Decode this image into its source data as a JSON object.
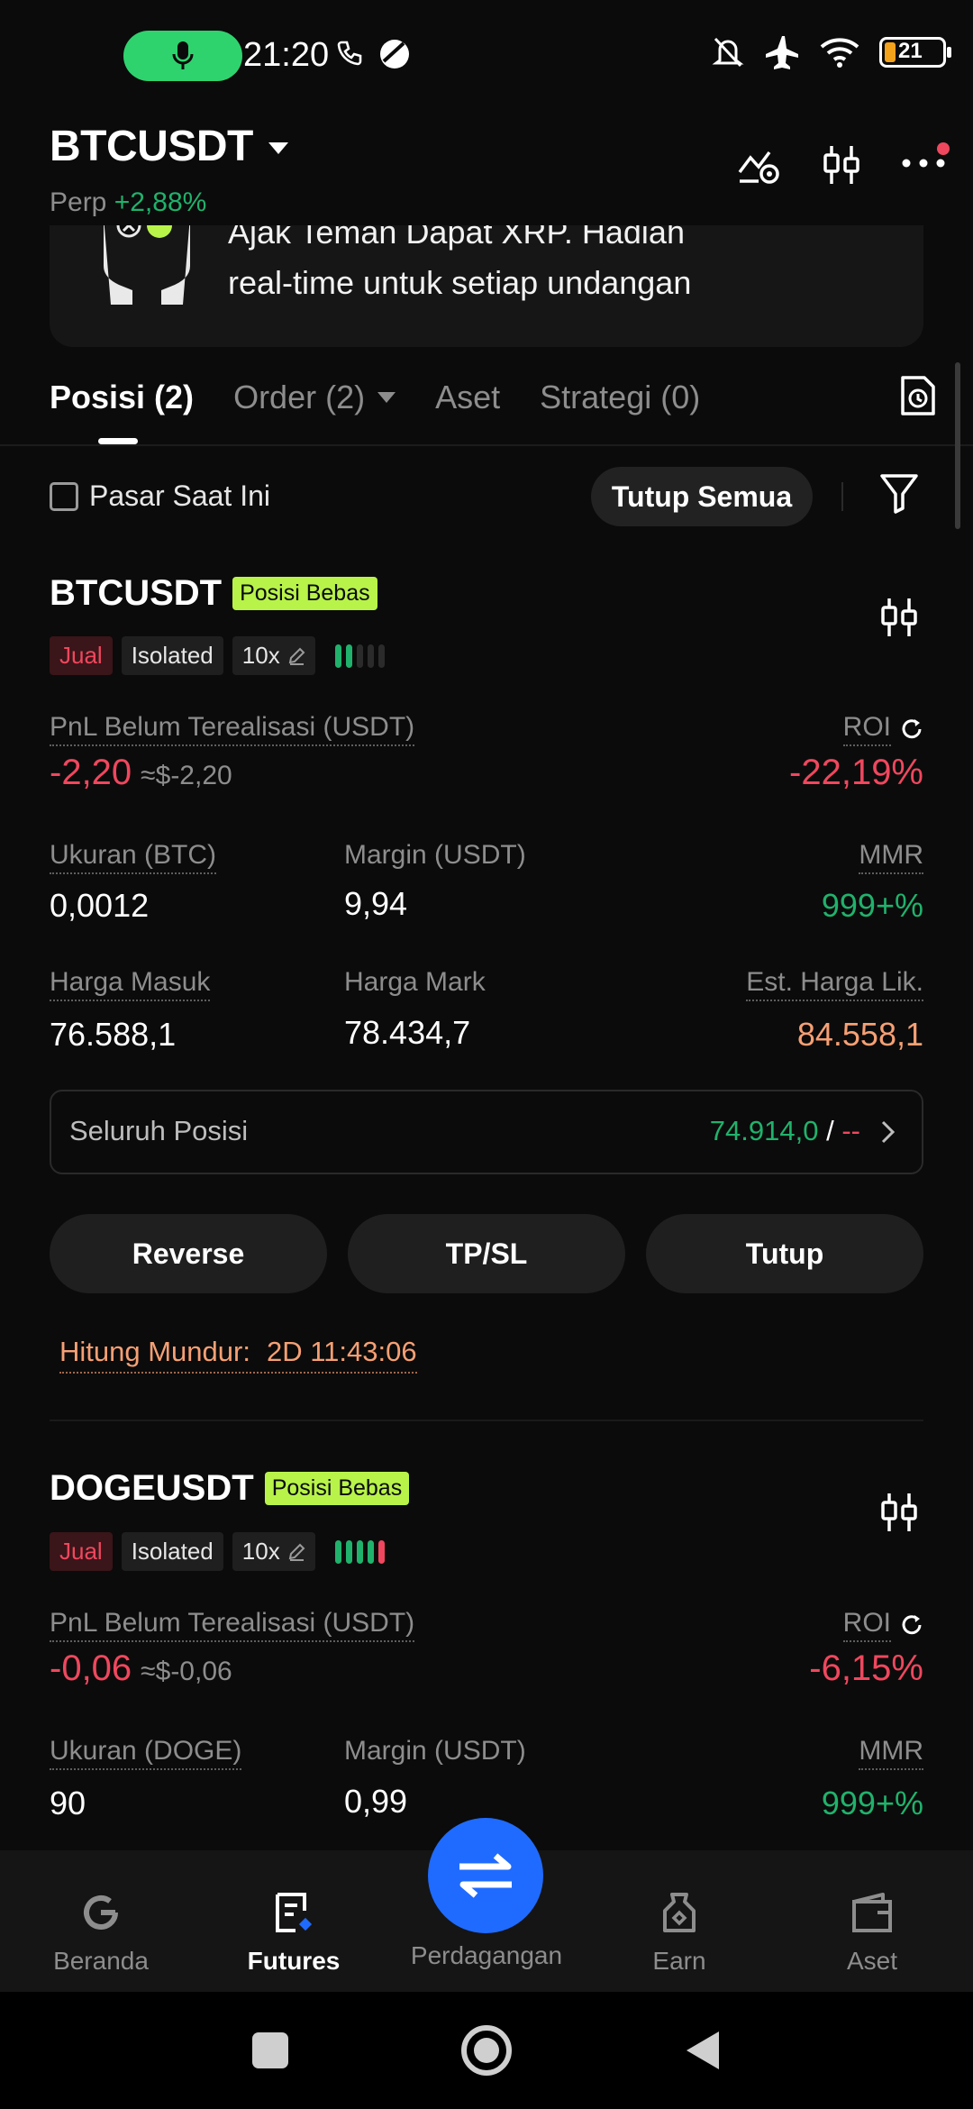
{
  "status_bar": {
    "time": "21:20",
    "battery": "21"
  },
  "header": {
    "symbol": "BTCUSDT",
    "perp_label": "Perp",
    "change": "+2,88%"
  },
  "banner": {
    "line1": "Ajak Teman Dapat XRP. Hadiah",
    "line2": "real-time untuk setiap undangan"
  },
  "tabs": [
    {
      "label": "Posisi (2)"
    },
    {
      "label": "Order (2)"
    },
    {
      "label": "Aset"
    },
    {
      "label": "Strategi (0)"
    }
  ],
  "filter": {
    "checkbox_label": "Pasar Saat Ini",
    "close_all": "Tutup Semua"
  },
  "positions": [
    {
      "symbol": "BTCUSDT",
      "badge": "Posisi Bebas",
      "side": "Jual",
      "margin_mode": "Isolated",
      "leverage": "10x",
      "pnl_label": "PnL Belum Terealisasi (USDT)",
      "pnl": "-2,20",
      "pnl_usd": "≈$-2,20",
      "roi_label": "ROI",
      "roi": "-22,19%",
      "size_label": "Ukuran (BTC)",
      "size": "0,0012",
      "margin_label": "Margin (USDT)",
      "margin": "9,94",
      "mmr_label": "MMR",
      "mmr": "999+%",
      "entry_label": "Harga Masuk",
      "entry": "76.588,1",
      "mark_label": "Harga Mark",
      "mark": "78.434,7",
      "liq_label": "Est. Harga Lik.",
      "liq": "84.558,1",
      "whole_label": "Seluruh Posisi",
      "whole_tp": "74.914,0",
      "whole_sep": "/",
      "whole_sl": "--",
      "btn_reverse": "Reverse",
      "btn_tpsl": "TP/SL",
      "btn_close": "Tutup",
      "countdown_label": "Hitung Mundur:",
      "countdown": "2D 11:43:06"
    },
    {
      "symbol": "DOGEUSDT",
      "badge": "Posisi Bebas",
      "side": "Jual",
      "margin_mode": "Isolated",
      "leverage": "10x",
      "pnl_label": "PnL Belum Terealisasi (USDT)",
      "pnl": "-0,06",
      "pnl_usd": "≈$-0,06",
      "roi_label": "ROI",
      "roi": "-6,15%",
      "size_label": "Ukuran (DOGE)",
      "size": "90",
      "margin_label": "Margin (USDT)",
      "margin": "0,99",
      "mmr_label": "MMR",
      "mmr": "999+%"
    }
  ],
  "bottom_nav": [
    {
      "label": "Beranda"
    },
    {
      "label": "Futures"
    },
    {
      "label": "Perdagangan"
    },
    {
      "label": "Earn"
    },
    {
      "label": "Aset"
    }
  ]
}
